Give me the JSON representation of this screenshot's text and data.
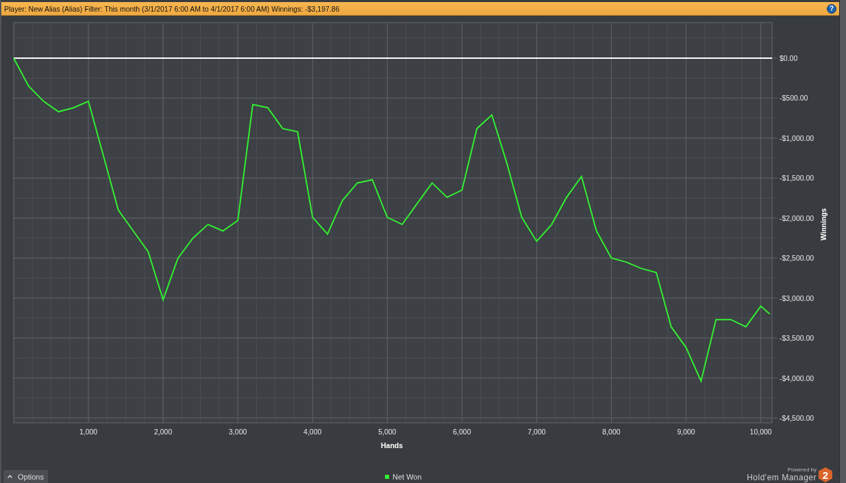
{
  "title_bar": {
    "text": "Player:  New Alias (Alias) Filter:  This month (3/1/2017 6:00 AM to 4/1/2017 6:00 AM) Winnings:  -$3,197.86"
  },
  "help_button": {
    "label": "?"
  },
  "chart_data": {
    "type": "line",
    "grid": true,
    "xlabel": "Hands",
    "ylabel": "Winnings",
    "xlim": [
      0,
      10150
    ],
    "ylim": [
      -4560,
      445
    ],
    "x": [
      0,
      200,
      400,
      600,
      800,
      1000,
      1200,
      1400,
      1600,
      1800,
      2000,
      2200,
      2400,
      2600,
      2800,
      3000,
      3200,
      3400,
      3600,
      3800,
      4000,
      4200,
      4400,
      4600,
      4800,
      5000,
      5200,
      5400,
      5600,
      5800,
      6000,
      6200,
      6400,
      6600,
      6800,
      7000,
      7200,
      7400,
      7600,
      7800,
      8000,
      8200,
      8400,
      8600,
      8800,
      9000,
      9200,
      9400,
      9600,
      9800,
      10000,
      10120
    ],
    "series": [
      {
        "name": "Net Won",
        "color": "#33ee33",
        "values": [
          0,
          -350,
          -540,
          -670,
          -620,
          -540,
          -1220,
          -1900,
          -2160,
          -2420,
          -3020,
          -2500,
          -2250,
          -2080,
          -2160,
          -2030,
          -580,
          -620,
          -880,
          -920,
          -1990,
          -2200,
          -1780,
          -1560,
          -1520,
          -1990,
          -2080,
          -1820,
          -1560,
          -1740,
          -1650,
          -880,
          -710,
          -1310,
          -1990,
          -2290,
          -2080,
          -1740,
          -1480,
          -2160,
          -2500,
          -2550,
          -2630,
          -2680,
          -3360,
          -3620,
          -4040,
          -3270,
          -3270,
          -3360,
          -3100,
          -3200
        ]
      }
    ],
    "xticks": [
      {
        "value": 1000,
        "label": "1,000"
      },
      {
        "value": 2000,
        "label": "2,000"
      },
      {
        "value": 3000,
        "label": "3,000"
      },
      {
        "value": 4000,
        "label": "4,000"
      },
      {
        "value": 5000,
        "label": "5,000"
      },
      {
        "value": 6000,
        "label": "6,000"
      },
      {
        "value": 7000,
        "label": "7,000"
      },
      {
        "value": 8000,
        "label": "8,000"
      },
      {
        "value": 9000,
        "label": "9,000"
      },
      {
        "value": 10000,
        "label": "10,000"
      }
    ],
    "yticks": [
      {
        "value": 0,
        "label": "$0.00"
      },
      {
        "value": -500,
        "label": "-$500.00"
      },
      {
        "value": -1000,
        "label": "-$1,000.00"
      },
      {
        "value": -1500,
        "label": "-$1,500.00"
      },
      {
        "value": -2000,
        "label": "-$2,000.00"
      },
      {
        "value": -2500,
        "label": "-$2,500.00"
      },
      {
        "value": -3000,
        "label": "-$3,000.00"
      },
      {
        "value": -3500,
        "label": "-$3,500.00"
      },
      {
        "value": -4000,
        "label": "-$4,000.00"
      },
      {
        "value": -4500,
        "label": "-$4,500.00"
      }
    ]
  },
  "options_button": {
    "label": "Options"
  },
  "branding": {
    "powered_by": "Powered by",
    "product": "Hold'em Manager",
    "badge": "2"
  }
}
